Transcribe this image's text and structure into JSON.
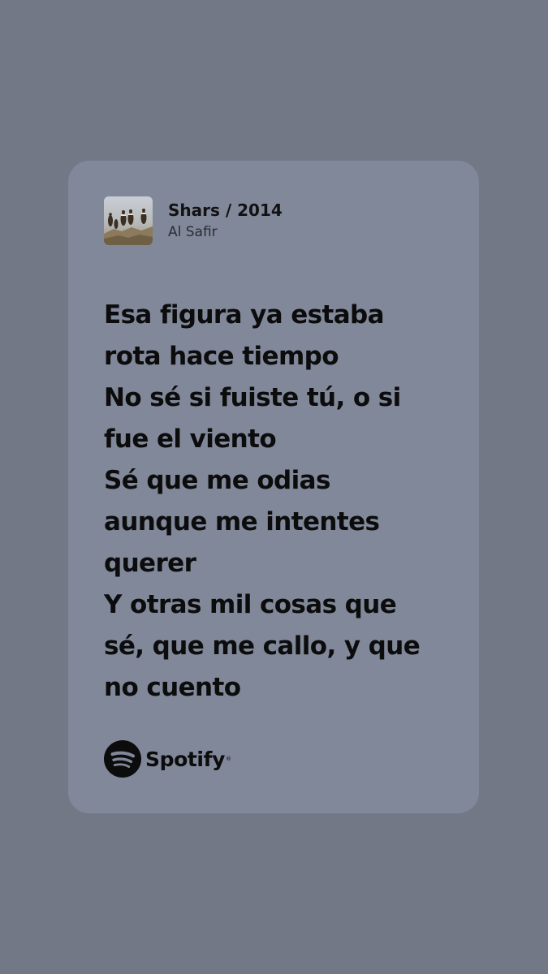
{
  "colors": {
    "background": "#727885",
    "card": "#818899",
    "text": "#0c0c0d"
  },
  "track": {
    "title": "Shars / 2014",
    "artist": "Al Safir",
    "cover_icon": "album-cover-vultures"
  },
  "lyrics": [
    "Esa figura ya estaba",
    "rota hace tiempo",
    "No sé si fuiste tú, o si",
    "fue el viento",
    "Sé que me odias",
    "aunque me intentes",
    "querer",
    "Y otras mil cosas que",
    "sé, que me callo, y que",
    "no cuento"
  ],
  "brand": {
    "name": "Spotify",
    "trademark": "®",
    "icon": "spotify-logo-icon"
  }
}
